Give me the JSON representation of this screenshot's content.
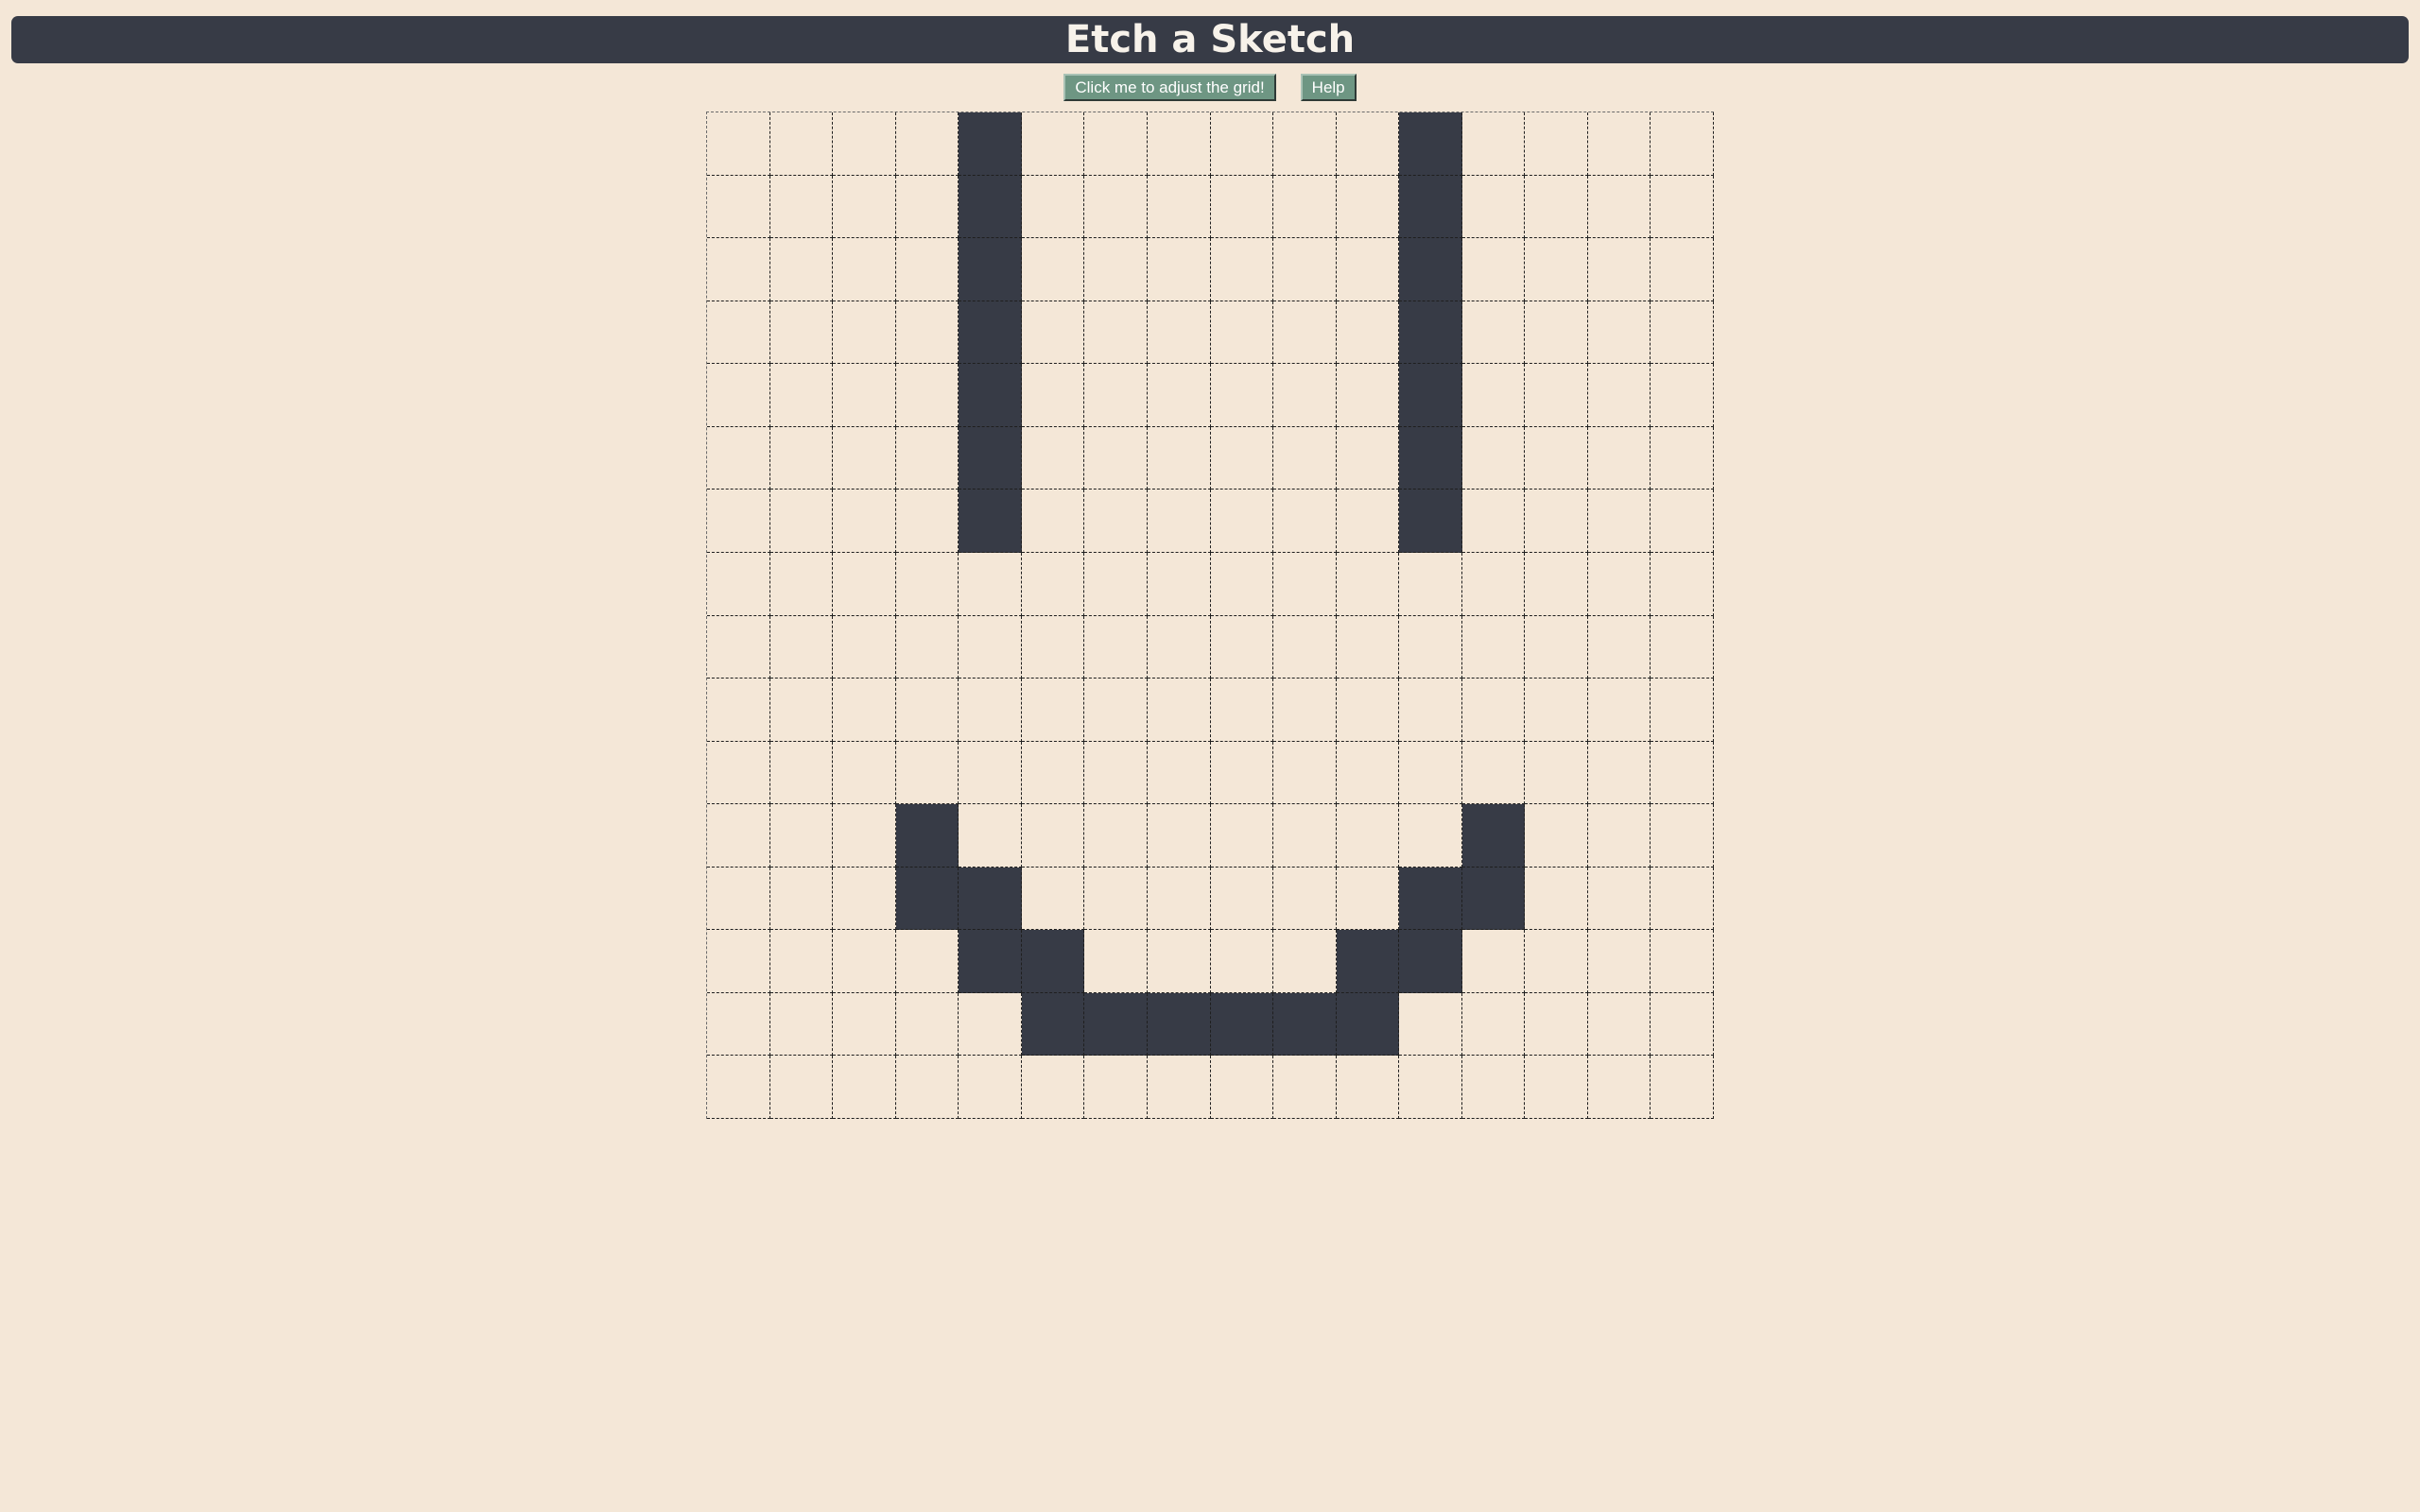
{
  "header": {
    "title": "Etch a Sketch"
  },
  "controls": {
    "adjust_label": "Click me to adjust the grid!",
    "help_label": "Help"
  },
  "grid": {
    "size": 16,
    "fill_color": "#373b46",
    "empty_color": "#f4e7d7",
    "filled": [
      [
        0,
        4
      ],
      [
        0,
        11
      ],
      [
        1,
        4
      ],
      [
        1,
        11
      ],
      [
        2,
        4
      ],
      [
        2,
        11
      ],
      [
        3,
        4
      ],
      [
        3,
        11
      ],
      [
        4,
        4
      ],
      [
        4,
        11
      ],
      [
        5,
        4
      ],
      [
        5,
        11
      ],
      [
        6,
        4
      ],
      [
        6,
        11
      ],
      [
        11,
        3
      ],
      [
        11,
        12
      ],
      [
        12,
        3
      ],
      [
        12,
        4
      ],
      [
        12,
        11
      ],
      [
        12,
        12
      ],
      [
        13,
        4
      ],
      [
        13,
        5
      ],
      [
        13,
        10
      ],
      [
        13,
        11
      ],
      [
        14,
        5
      ],
      [
        14,
        6
      ],
      [
        14,
        7
      ],
      [
        14,
        8
      ],
      [
        14,
        9
      ],
      [
        14,
        10
      ]
    ]
  },
  "colors": {
    "background": "#f4e7d7",
    "header": "#373b46",
    "button": "#6e9683"
  }
}
